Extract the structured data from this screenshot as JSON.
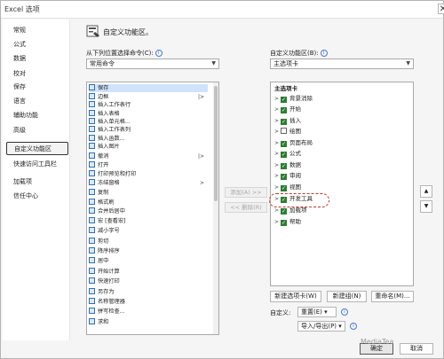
{
  "window": {
    "title": "Excel 选项",
    "help_btn": "?",
    "close_btn": "✕"
  },
  "nav": {
    "items": [
      {
        "label": "常规"
      },
      {
        "label": "公式"
      },
      {
        "label": "数据"
      },
      {
        "label": "校对"
      },
      {
        "label": "保存"
      },
      {
        "label": "语言"
      },
      {
        "label": "辅助功能"
      },
      {
        "label": "高级"
      },
      {
        "label": "自定义功能区"
      },
      {
        "label": "快速访问工具栏"
      },
      {
        "label": "加载项"
      },
      {
        "label": "信任中心"
      }
    ],
    "selected": "自定义功能区"
  },
  "header": {
    "title": "自定义功能区。"
  },
  "left_panel": {
    "label": "从下列位置选择命令(C):",
    "combo_value": "常用命令",
    "commands": [
      {
        "label": "保存",
        "sub": ""
      },
      {
        "label": "边框",
        "sub": "|>"
      },
      {
        "label": "插入工作表行",
        "sub": ""
      },
      {
        "label": "插入表格",
        "sub": ""
      },
      {
        "label": "插入单元格...",
        "sub": ""
      },
      {
        "label": "插入工作表列",
        "sub": ""
      },
      {
        "label": "插入函数...",
        "sub": ""
      },
      {
        "label": "插入图片",
        "sub": ""
      },
      {
        "label": "撤消",
        "sub": "|>"
      },
      {
        "label": "打开",
        "sub": ""
      },
      {
        "label": "打印预览和打印",
        "sub": ""
      },
      {
        "label": "冻结窗格",
        "sub": ">"
      },
      {
        "label": "复制",
        "sub": ""
      },
      {
        "label": "格式刷",
        "sub": ""
      },
      {
        "label": "合并后居中",
        "sub": ""
      },
      {
        "label": "宏 [查看宏]",
        "sub": ""
      },
      {
        "label": "减小字号",
        "sub": ""
      },
      {
        "label": "剪切",
        "sub": ""
      },
      {
        "label": "降序排序",
        "sub": ""
      },
      {
        "label": "居中",
        "sub": ""
      },
      {
        "label": "开始计算",
        "sub": ""
      },
      {
        "label": "快速打印",
        "sub": ""
      },
      {
        "label": "另存为",
        "sub": ""
      },
      {
        "label": "名称管理器",
        "sub": ""
      },
      {
        "label": "拼写检查...",
        "sub": ""
      },
      {
        "label": "求和",
        "sub": ""
      }
    ]
  },
  "middle": {
    "add_label": "添加(A) >>",
    "remove_label": "<< 删除(R)"
  },
  "right_panel": {
    "label": "自定义功能区(B):",
    "combo_value": "主选项卡",
    "group_header": "主选项卡",
    "tabs": [
      {
        "label": "背景消除",
        "checked": true
      },
      {
        "label": "开始",
        "checked": true
      },
      {
        "label": "插入",
        "checked": true
      },
      {
        "label": "绘图",
        "checked": false
      },
      {
        "label": "页面布局",
        "checked": true
      },
      {
        "label": "公式",
        "checked": true
      },
      {
        "label": "数据",
        "checked": true
      },
      {
        "label": "审阅",
        "checked": true
      },
      {
        "label": "视图",
        "checked": true
      },
      {
        "label": "开发工具",
        "checked": true
      },
      {
        "label": "加载项",
        "checked": true
      },
      {
        "label": "帮助",
        "checked": true
      }
    ],
    "new_tab": "新建选项卡(W)",
    "new_group": "新建组(N)",
    "rename": "重命名(M)...",
    "custom_label": "自定义:",
    "reset": "重置(E)",
    "import_export": "导入/导出(P)"
  },
  "footer": {
    "ok": "确定",
    "cancel": "取消",
    "watermark": "MediaTea"
  }
}
